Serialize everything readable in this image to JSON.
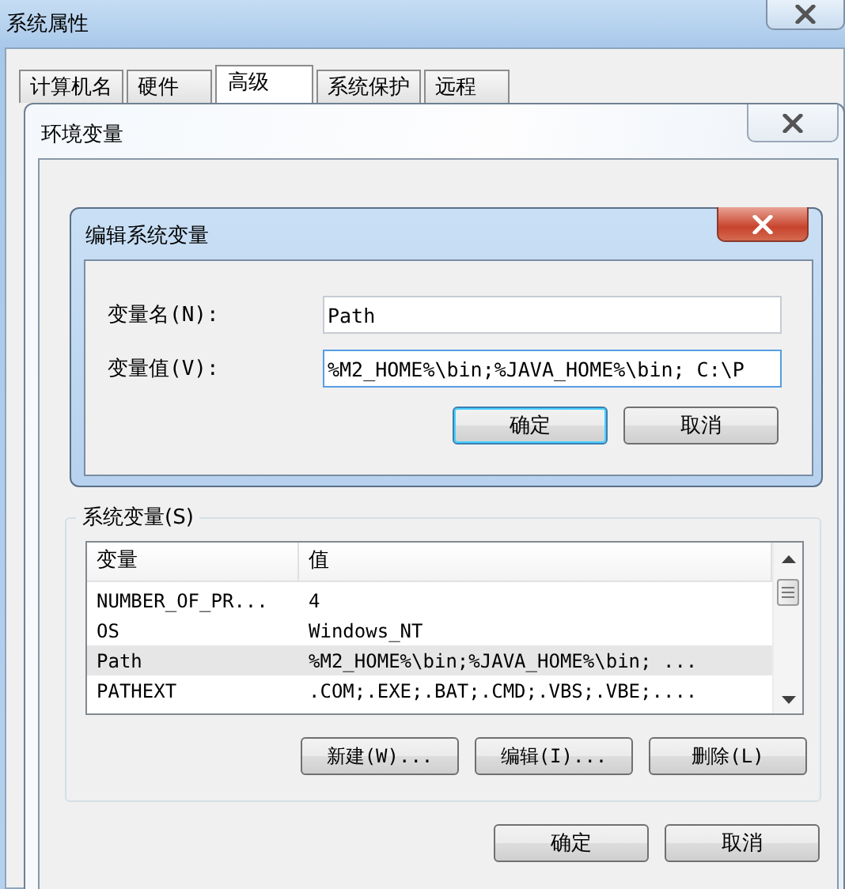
{
  "system_properties": {
    "title": "系统属性",
    "tabs": [
      {
        "label": "计算机名",
        "selected": false
      },
      {
        "label": "硬件",
        "selected": false
      },
      {
        "label": "高级",
        "selected": true
      },
      {
        "label": "系统保护",
        "selected": false
      },
      {
        "label": "远程",
        "selected": false
      }
    ]
  },
  "environment_variables": {
    "title": "环境变量",
    "system_variables": {
      "label": "系统变量(S)",
      "columns": [
        "变量",
        "值"
      ],
      "rows": [
        {
          "name": "NUMBER_OF_PR...",
          "value": "4",
          "selected": false
        },
        {
          "name": "OS",
          "value": "Windows_NT",
          "selected": false
        },
        {
          "name": "Path",
          "value": "%M2_HOME%\\bin;%JAVA_HOME%\\bin; ...",
          "selected": true
        },
        {
          "name": "PATHEXT",
          "value": ".COM;.EXE;.BAT;.CMD;.VBS;.VBE;....",
          "selected": false
        }
      ],
      "buttons": [
        "新建(W)...",
        "编辑(I)...",
        "删除(L)"
      ]
    },
    "buttons": [
      "确定",
      "取消"
    ]
  },
  "edit_dialog": {
    "title": "编辑系统变量",
    "fields": [
      {
        "label": "变量名(N):",
        "value": "Path"
      },
      {
        "label": "变量值(V):",
        "value": "%M2_HOME%\\bin;%JAVA_HOME%\\bin; C:\\P"
      }
    ],
    "buttons": [
      {
        "label": "确定",
        "focused": true
      },
      {
        "label": "取消",
        "focused": false
      }
    ]
  }
}
